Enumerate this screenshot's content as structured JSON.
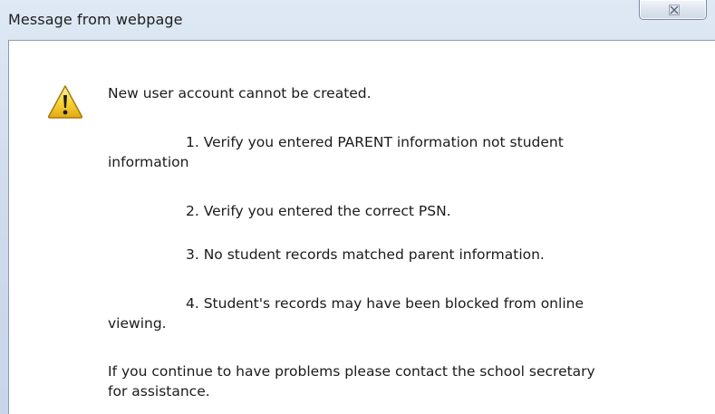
{
  "dialog": {
    "title": "Message from webpage",
    "close_label": "☒",
    "icon": "warning-icon",
    "message": {
      "headline": "New user account cannot be created.",
      "item1_a": "1. Verify you entered PARENT information not student",
      "item1_b": "information",
      "item2": "2. Verify you entered the correct PSN.",
      "item3": "3. No student records matched parent information.",
      "item4_a": "4. Student's records may have been blocked from online",
      "item4_b": "viewing.",
      "footer_a": "If you continue to have problems please contact the school secretary",
      "footer_b": "for assistance."
    }
  }
}
